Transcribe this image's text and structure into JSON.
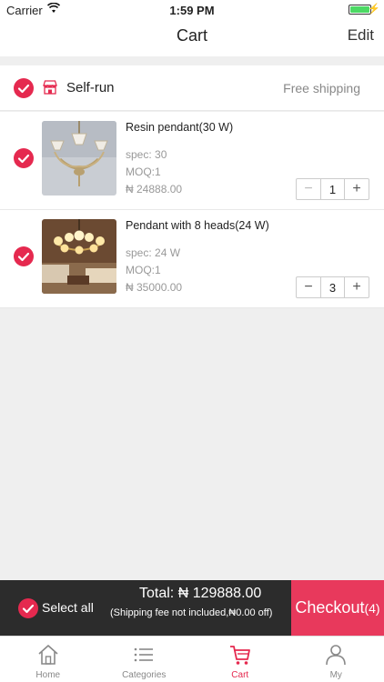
{
  "status_bar": {
    "carrier": "Carrier",
    "time": "1:59 PM"
  },
  "nav": {
    "title": "Cart",
    "edit_label": "Edit"
  },
  "store": {
    "name": "Self-run",
    "shipping": "Free shipping"
  },
  "items": [
    {
      "name": "Resin pendant(30 W)",
      "spec": "spec: 30",
      "moq": "MOQ:1",
      "price": "₦ 24888.00",
      "quantity": "1",
      "minus_enabled": false
    },
    {
      "name": "Pendant with 8 heads(24 W)",
      "spec": "spec: 24 W",
      "moq": "MOQ:1",
      "price": "₦ 35000.00",
      "quantity": "3",
      "minus_enabled": true
    }
  ],
  "checkout_bar": {
    "select_all_label": "Select all",
    "total": "Total:  ₦ 129888.00",
    "fee_note": "(Shipping fee not included,₦0.00 off)",
    "checkout_label": "Checkout",
    "checkout_count": "(4)"
  },
  "tabs": [
    {
      "label": "Home",
      "icon": "home-icon",
      "active": false
    },
    {
      "label": "Categories",
      "icon": "list-icon",
      "active": false
    },
    {
      "label": "Cart",
      "icon": "cart-icon",
      "active": true
    },
    {
      "label": "My",
      "icon": "user-icon",
      "active": false
    }
  ],
  "colors": {
    "accent": "#e5294f",
    "checkout_bg": "#e8395c",
    "bar_bg": "#2c2c2c"
  }
}
